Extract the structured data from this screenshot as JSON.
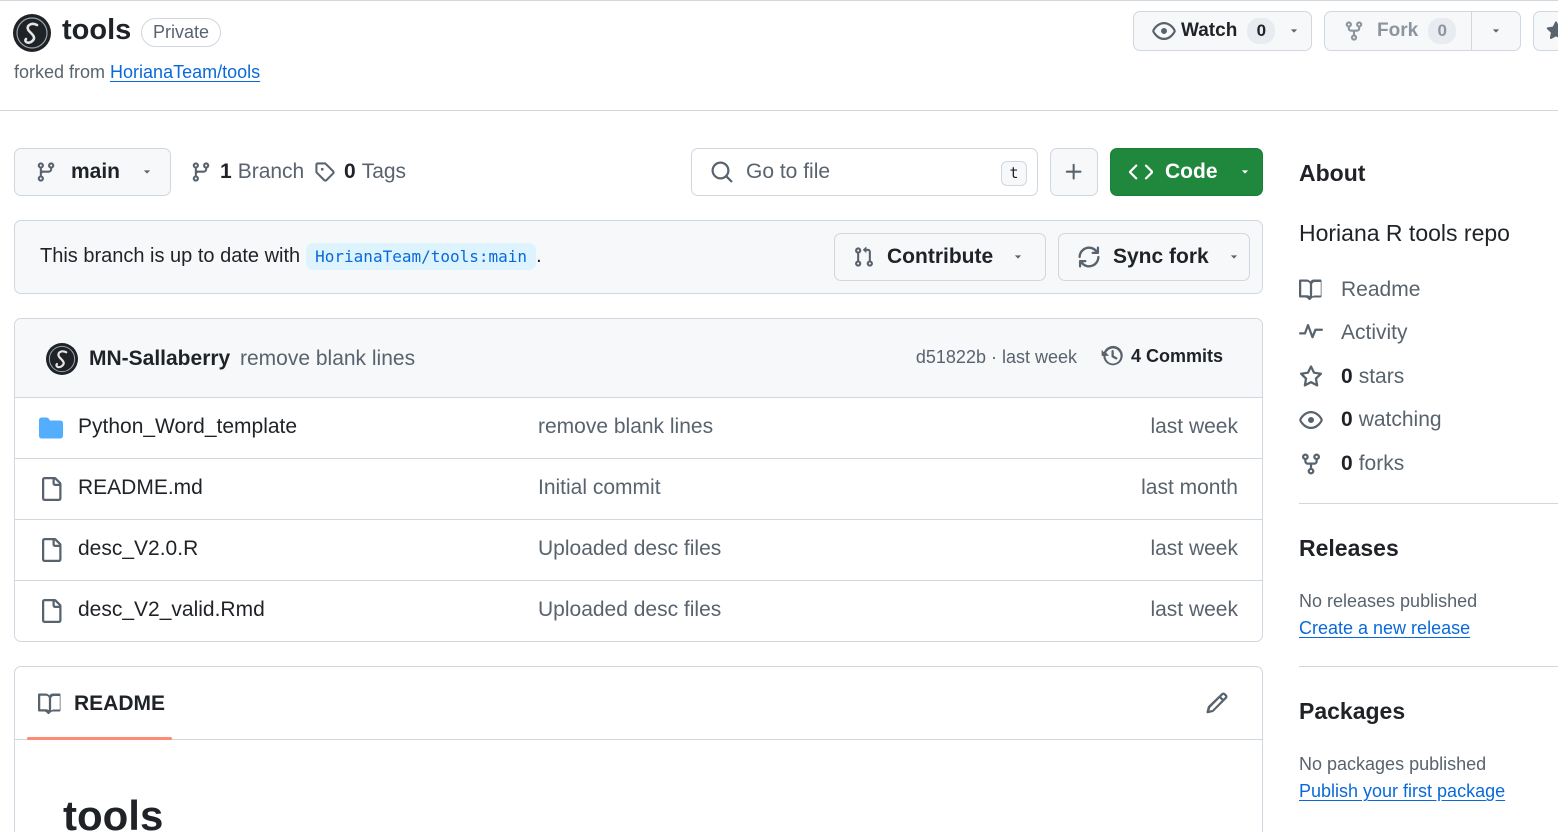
{
  "repo": {
    "name": "tools",
    "visibility": "Private",
    "forked_prefix": "forked from",
    "forked_from": "HorianaTeam/tools"
  },
  "header_actions": {
    "watch_label": "Watch",
    "watch_count": "0",
    "fork_label": "Fork",
    "fork_count": "0"
  },
  "toolbar": {
    "branch": "main",
    "branches_count": "1",
    "branches_label": "Branch",
    "tags_count": "0",
    "tags_label": "Tags",
    "goto_placeholder": "Go to file",
    "goto_shortcut": "t",
    "code_label": "Code"
  },
  "sync": {
    "text": "This branch is up to date with",
    "ref": "HorianaTeam/tools:main",
    "suffix": ".",
    "contribute_label": "Contribute",
    "sync_label": "Sync fork"
  },
  "last_commit": {
    "author": "MN-Sallaberry",
    "message": "remove blank lines",
    "sha_time": "d51822b · last week",
    "commits_count": "4",
    "commits_label": "Commits"
  },
  "files": [
    {
      "type": "folder",
      "name": "Python_Word_template",
      "message": "remove blank lines",
      "time": "last week"
    },
    {
      "type": "file",
      "name": "README.md",
      "message": "Initial commit",
      "time": "last month"
    },
    {
      "type": "file",
      "name": "desc_V2.0.R",
      "message": "Uploaded desc files",
      "time": "last week"
    },
    {
      "type": "file",
      "name": "desc_V2_valid.Rmd",
      "message": "Uploaded desc files",
      "time": "last week"
    }
  ],
  "readme": {
    "tab_label": "README",
    "title": "tools"
  },
  "about": {
    "heading": "About",
    "description": "Horiana R tools repo",
    "readme_label": "Readme",
    "activity_label": "Activity",
    "stars_count": "0",
    "stars_label": "stars",
    "watching_count": "0",
    "watching_label": "watching",
    "forks_count": "0",
    "forks_label": "forks"
  },
  "releases": {
    "heading": "Releases",
    "empty": "No releases published",
    "link": "Create a new release"
  },
  "packages": {
    "heading": "Packages",
    "empty": "No packages published",
    "link": "Publish your first package"
  },
  "colors": {
    "accent_link": "#0969da",
    "code_button": "#1f883d",
    "folder_icon": "#54aeff",
    "tab_underline": "#fd8c73"
  }
}
